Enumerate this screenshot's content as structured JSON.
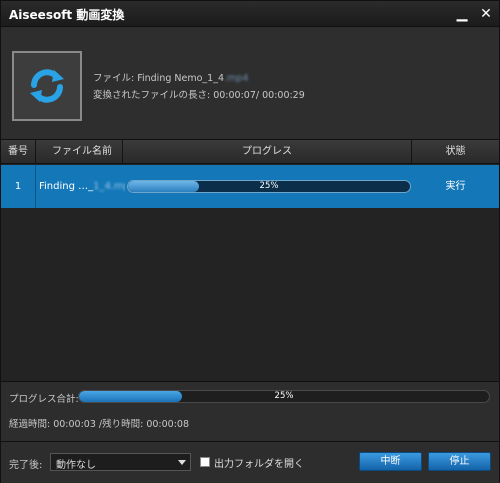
{
  "window": {
    "title": "Aiseesoft 動画変換",
    "minimize_glyph": "▁",
    "close_glyph": "✕"
  },
  "info": {
    "icon": "refresh-arrows-icon",
    "file_label": "ファイル: Finding Nemo_1_4",
    "file_blurred": ".mp4",
    "length_text": "変換されたファイルの長さ: 00:00:07/ 00:00:29"
  },
  "table": {
    "headers": [
      "番号",
      "ファイル名前",
      "プログレス",
      "状態"
    ],
    "rows": [
      {
        "no": "1",
        "name_visible": "Finding …_",
        "name_blurred": "1_4.mp4",
        "progress_value": 25,
        "progress_text": "25%",
        "state": "実行"
      }
    ]
  },
  "total": {
    "label": "プログレス合計:",
    "progress_value": 25,
    "progress_text": "25%",
    "elapsed_text": "経過時間: 00:00:03 /残り時間: 00:00:08"
  },
  "footer": {
    "after_label": "完了後:",
    "after_select_value": "動作なし",
    "open_folder_label": "出力フォルダを開く",
    "pause_label": "中断",
    "stop_label": "停止"
  },
  "colors": {
    "accent": "#1377b8",
    "window_bg": "#2d2d2d"
  }
}
